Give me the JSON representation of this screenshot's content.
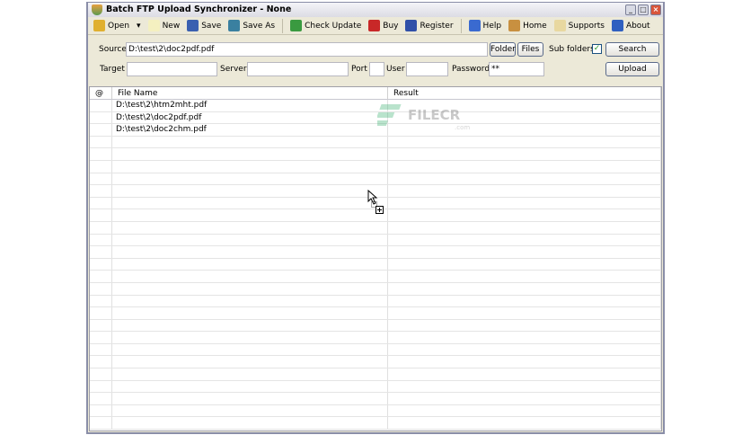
{
  "window": {
    "title": "Batch FTP Upload Synchronizer - None"
  },
  "toolbar": {
    "items": [
      {
        "label": "Open",
        "icon": "open-folder-icon",
        "color": "#e0b030"
      },
      {
        "label": "New",
        "icon": "new-file-icon",
        "color": "#f4f0c0"
      },
      {
        "label": "Save",
        "icon": "save-icon",
        "color": "#3a60b0"
      },
      {
        "label": "Save As",
        "icon": "save-as-icon",
        "color": "#3a80a0"
      },
      {
        "label": "Check Update",
        "icon": "update-icon",
        "color": "#3a9a40"
      },
      {
        "label": "Buy",
        "icon": "cart-icon",
        "color": "#c82828"
      },
      {
        "label": "Register",
        "icon": "register-icon",
        "color": "#3050a8"
      },
      {
        "label": "Help",
        "icon": "help-icon",
        "color": "#3a6ad0"
      },
      {
        "label": "Home",
        "icon": "home-icon",
        "color": "#c89040"
      },
      {
        "label": "Supports",
        "icon": "mail-icon",
        "color": "#e8d8a0"
      },
      {
        "label": "About",
        "icon": "info-icon",
        "color": "#3060c0"
      }
    ]
  },
  "form": {
    "source_label": "Source",
    "source_value": "D:\\test\\2\\doc2pdf.pdf",
    "folder_button": "Folder",
    "files_button": "Files",
    "subfolders_label": "Sub folders",
    "subfolders_checked": true,
    "search_button": "Search",
    "target_label": "Target",
    "target_value": "",
    "server_label": "Server",
    "server_value": "",
    "port_label": "Port",
    "port_value": "",
    "user_label": "User",
    "user_value": "",
    "password_label": "Password",
    "password_value": "**",
    "upload_button": "Upload"
  },
  "list": {
    "columns": [
      "@",
      "File Name",
      "Result"
    ],
    "rows": [
      {
        "status": "",
        "file": "D:\\test\\2\\htm2mht.pdf",
        "result": ""
      },
      {
        "status": "",
        "file": "D:\\test\\2\\doc2pdf.pdf",
        "result": ""
      },
      {
        "status": "",
        "file": "D:\\test\\2\\doc2chm.pdf",
        "result": ""
      }
    ]
  },
  "watermark": {
    "text": "FILECR",
    "sub": ".com"
  }
}
